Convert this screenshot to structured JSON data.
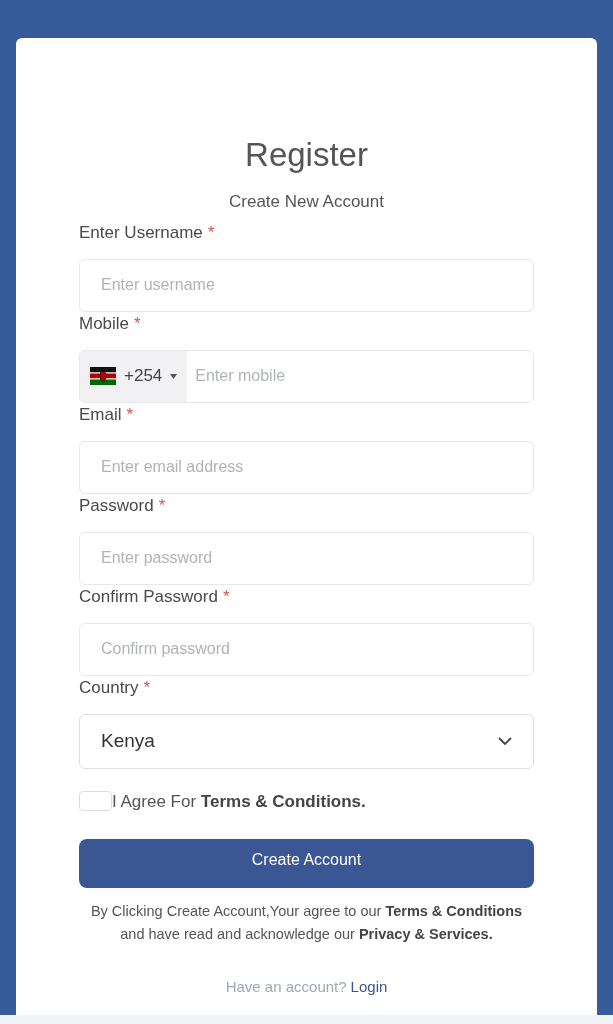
{
  "card": {
    "title": "Register",
    "subtitle": "Create New Account"
  },
  "fields": [
    {
      "kind": "text",
      "label": "Enter Username",
      "required_mark": "*",
      "placeholder": "Enter username"
    },
    {
      "kind": "phone",
      "label": "Mobile",
      "required_mark": "*",
      "dial_code": "+254",
      "placeholder": "Enter mobile"
    },
    {
      "kind": "text",
      "label": "Email",
      "required_mark": "*",
      "placeholder": "Enter email address"
    },
    {
      "kind": "text",
      "label": "Password",
      "required_mark": "*",
      "placeholder": "Enter password"
    },
    {
      "kind": "text",
      "label": "Confirm Password",
      "required_mark": "*",
      "placeholder": "Confirm password"
    },
    {
      "kind": "select",
      "label": "Country",
      "required_mark": "*",
      "value": "Kenya"
    }
  ],
  "agree": {
    "checked": false,
    "text": "I Agree For **Terms & Conditions.**"
  },
  "submit": "Create Account",
  "note": "By Clicking Create Account,Your agree to our **Terms & Conditions** and have read and acknowledge our **Privacy & Services.**",
  "login": {
    "prompt": "Have an account?",
    "link": "Login"
  }
}
